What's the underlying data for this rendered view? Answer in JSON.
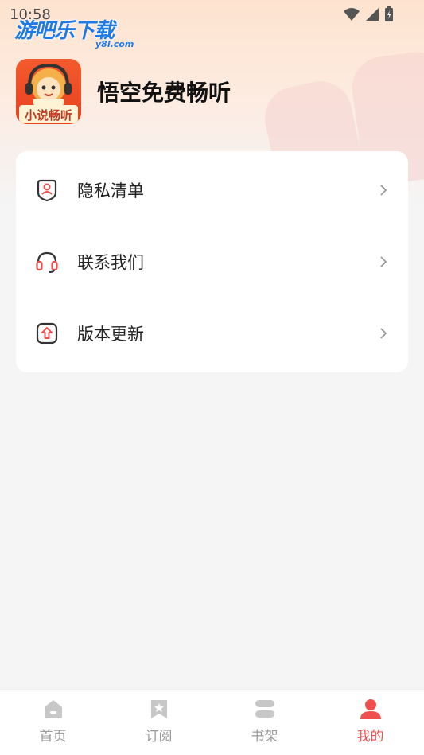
{
  "status_bar": {
    "time": "10:58"
  },
  "watermark": {
    "text": "游吧乐下载",
    "sub": "y8l.com"
  },
  "profile": {
    "app_name": "悟空免费畅听",
    "logo_caption": "小说畅听"
  },
  "menu": [
    {
      "label": "隐私清单",
      "icon": "privacy-icon"
    },
    {
      "label": "联系我们",
      "icon": "headset-icon"
    },
    {
      "label": "版本更新",
      "icon": "update-icon"
    }
  ],
  "tabs": [
    {
      "label": "首页",
      "icon": "home-icon",
      "active": false
    },
    {
      "label": "订阅",
      "icon": "bookmark-icon",
      "active": false
    },
    {
      "label": "书架",
      "icon": "bookshelf-icon",
      "active": false
    },
    {
      "label": "我的",
      "icon": "profile-icon",
      "active": true
    }
  ],
  "colors": {
    "accent": "#f0504d",
    "inactive": "#c7c7c7",
    "brand": "#e8401f"
  }
}
